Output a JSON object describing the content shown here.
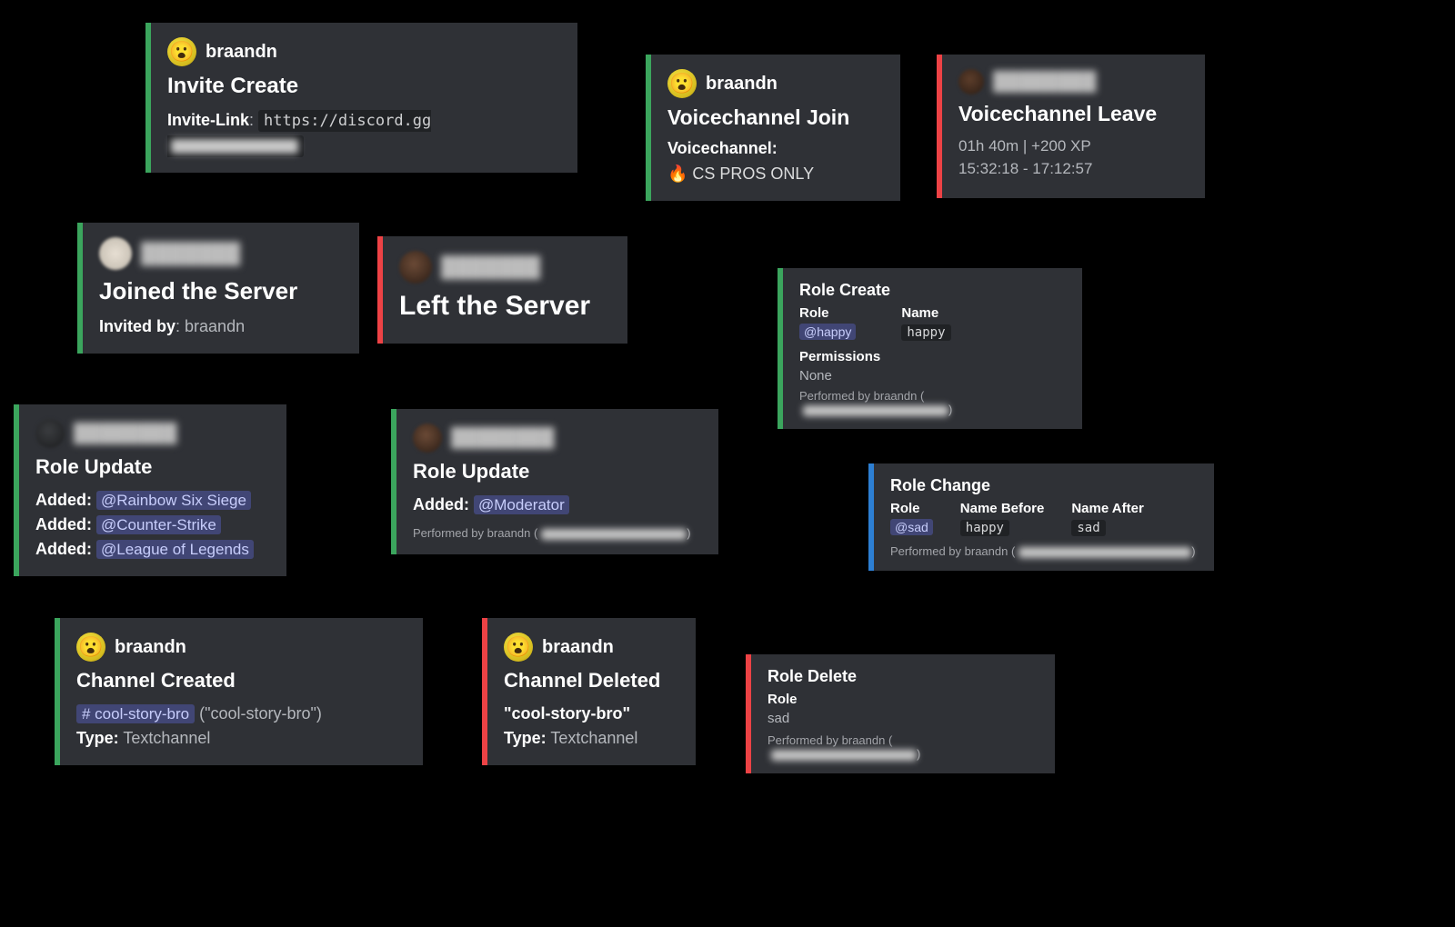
{
  "users": {
    "braandn": "braandn",
    "hidden": "████████"
  },
  "cards": {
    "inviteCreate": {
      "user": "braandn",
      "title": "Invite Create",
      "linkLabel": "Invite-Link",
      "linkPrefix": "https://discord.gg"
    },
    "vcJoin": {
      "user": "braandn",
      "title": "Voicechannel Join",
      "subLabel": "Voicechannel:",
      "channel": "🔥 CS PROS ONLY"
    },
    "vcLeave": {
      "title": "Voicechannel Leave",
      "line1": "01h 40m | +200 XP",
      "line2": "15:32:18 - 17:12:57"
    },
    "joined": {
      "title": "Joined the Server",
      "invitedLabel": "Invited by",
      "invitedBy": "braandn"
    },
    "left": {
      "title": "Left the Server"
    },
    "roleCreate": {
      "title": "Role Create",
      "roleLabel": "Role",
      "roleMention": "@happy",
      "nameLabel": "Name",
      "nameVal": "happy",
      "permLabel": "Permissions",
      "permVal": "None",
      "footer": "Performed by braandn ("
    },
    "roleUpdate1": {
      "title": "Role Update",
      "addedLabel": "Added:",
      "roles": [
        "@Rainbow Six Siege",
        "@Counter-Strike",
        "@League of Legends"
      ]
    },
    "roleUpdate2": {
      "title": "Role Update",
      "addedLabel": "Added:",
      "role": "@Moderator",
      "footer": "Performed by braandn ("
    },
    "roleChange": {
      "title": "Role Change",
      "roleLabel": "Role",
      "roleMention": "@sad",
      "beforeLabel": "Name Before",
      "beforeVal": "happy",
      "afterLabel": "Name After",
      "afterVal": "sad",
      "footer": "Performed by braandn ("
    },
    "channelCreated": {
      "user": "braandn",
      "title": "Channel Created",
      "hash": "# cool-story-bro",
      "paren": "(\"cool-story-bro\")",
      "typeLabel": "Type:",
      "typeVal": "Textchannel"
    },
    "channelDeleted": {
      "user": "braandn",
      "title": "Channel Deleted",
      "name": "\"cool-story-bro\"",
      "typeLabel": "Type:",
      "typeVal": "Textchannel"
    },
    "roleDelete": {
      "title": "Role Delete",
      "roleLabel": "Role",
      "roleVal": "sad",
      "footer": "Performed by braandn ("
    }
  }
}
